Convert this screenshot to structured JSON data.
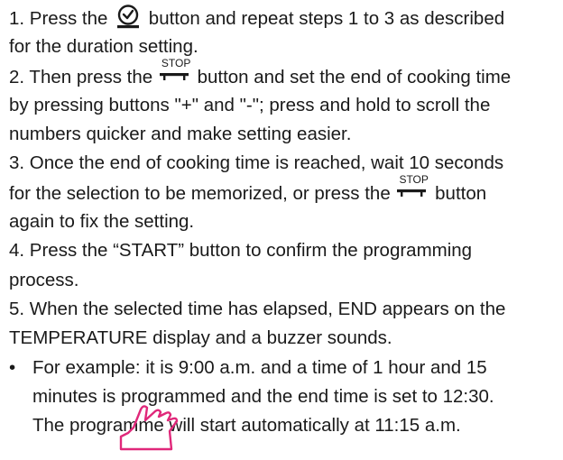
{
  "icons": {
    "clock_button": "clock-icon",
    "stop_button": "stop-button-icon",
    "cursor": "hand-cursor-icon"
  },
  "stop_label": "STOP",
  "lines": {
    "l1a": "1. Press the",
    "l1b": "button and repeat steps 1 to 3 as described",
    "l2": "for the duration setting.",
    "l3a": "2. Then press the",
    "l3b": "button and set the end of cooking time",
    "l4": "by pressing buttons \"+\" and \"-\"; press and hold to scroll the",
    "l5": "numbers quicker and make setting easier.",
    "l6": "3. Once the end of cooking time is reached, wait 10 seconds",
    "l7a": "for the selection to be memorized, or press the",
    "l7b": "button",
    "l8": "again to fix the setting.",
    "l9": "4. Press the “START” button to confirm the programming",
    "l10": "process.",
    "l11": "5. When the selected time has elapsed, END appears on the",
    "l12": "TEMPERATURE display and a buzzer sounds.",
    "bullet": "•",
    "l13": "For example: it is 9:00 a.m. and a time of 1 hour and 15",
    "l14": "minutes is programmed and the end time is set to 12:30.",
    "l15": "The programme will start automatically at 11:15 a.m."
  }
}
